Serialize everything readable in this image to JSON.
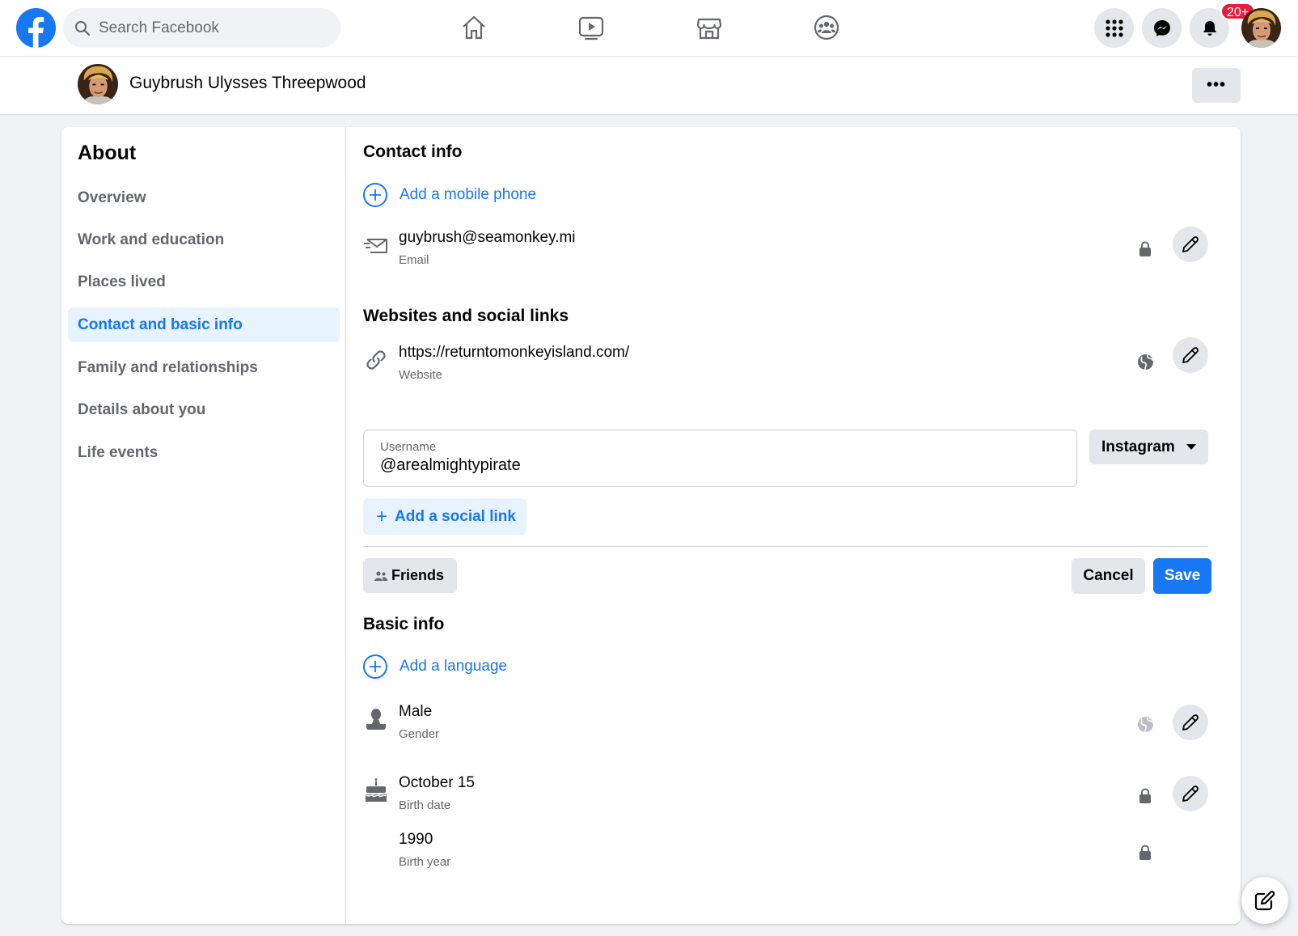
{
  "search": {
    "placeholder": "Search Facebook"
  },
  "nav": {
    "icons": [
      "home-icon",
      "watch-icon",
      "marketplace-icon",
      "groups-icon"
    ],
    "notification_badge": "20+"
  },
  "profile": {
    "name": "Guybrush Ulysses Threepwood",
    "more_label": "•••"
  },
  "sidebar": {
    "title": "About",
    "items": [
      {
        "label": "Overview",
        "active": false
      },
      {
        "label": "Work and education",
        "active": false
      },
      {
        "label": "Places lived",
        "active": false
      },
      {
        "label": "Contact and basic info",
        "active": true
      },
      {
        "label": "Family and relationships",
        "active": false
      },
      {
        "label": "Details about you",
        "active": false
      },
      {
        "label": "Life events",
        "active": false
      }
    ]
  },
  "contact": {
    "title": "Contact info",
    "add_phone": "Add a mobile phone",
    "email": {
      "value": "guybrush@seamonkey.mi",
      "label": "Email",
      "privacy": "lock-icon"
    }
  },
  "websites": {
    "title": "Websites and social links",
    "website": {
      "value": "https://returntomonkeyisland.com/",
      "label": "Website",
      "privacy": "globe-icon"
    },
    "username_field": {
      "label": "Username",
      "value": "@arealmightypirate"
    },
    "platform": "Instagram",
    "add_social": "Add a social link",
    "audience": "Friends",
    "cancel": "Cancel",
    "save": "Save"
  },
  "basic": {
    "title": "Basic info",
    "add_language": "Add a language",
    "gender": {
      "value": "Male",
      "label": "Gender",
      "privacy": "globe-icon"
    },
    "birth_date": {
      "value": "October 15",
      "label": "Birth date",
      "privacy": "lock-icon"
    },
    "birth_year": {
      "value": "1990",
      "label": "Birth year",
      "privacy": "lock-icon"
    }
  },
  "colors": {
    "accent": "#1877f2",
    "badge": "#e41e3f",
    "secondary_text": "#65676b",
    "button_bg": "#e4e6eb"
  }
}
